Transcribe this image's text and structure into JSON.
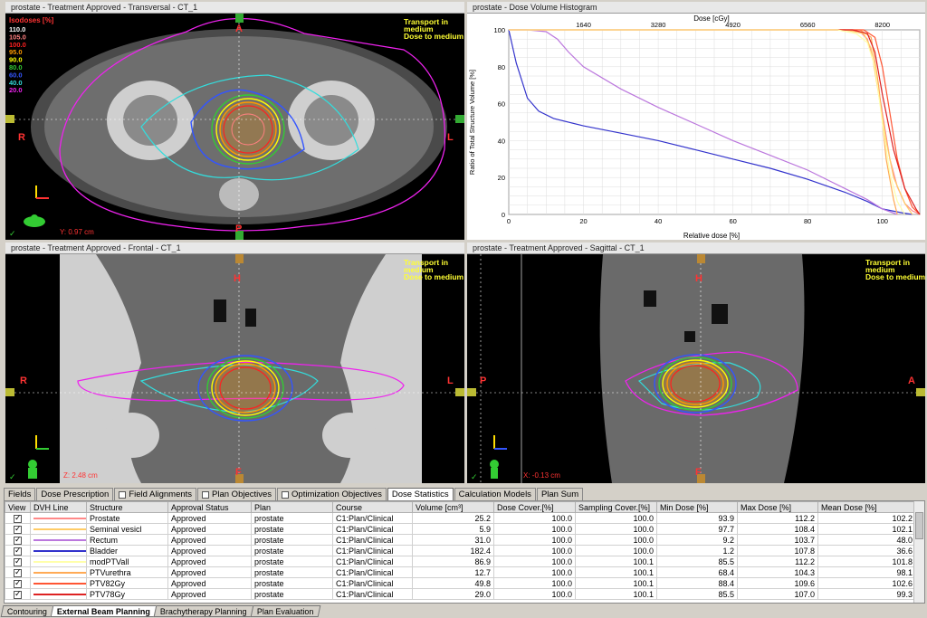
{
  "viewports": {
    "transversal": {
      "title": "prostate  -  Treatment Approved - Transversal - CT_1",
      "pos_readout": "Y: 0.97 cm",
      "orient": {
        "top": "A",
        "bottom": "P",
        "left": "R",
        "right": "L"
      }
    },
    "dvh": {
      "title": "prostate  -  Dose Volume Histogram"
    },
    "frontal": {
      "title": "prostate  -  Treatment Approved - Frontal - CT_1",
      "pos_readout": "Z: 2.48 cm",
      "orient": {
        "top": "H",
        "bottom": "F",
        "left": "R",
        "right": "L"
      }
    },
    "sagittal": {
      "title": "prostate  -  Treatment Approved - Sagittal - CT_1",
      "pos_readout": "X: -0.13 cm",
      "orient": {
        "top": "H",
        "bottom": "F",
        "left": "P",
        "right": "A"
      }
    }
  },
  "transport_lines": [
    "Transport in",
    "medium",
    "Dose to medium"
  ],
  "isodose_legend": {
    "title": "Isodoses [%]",
    "levels": [
      {
        "label": "110.0",
        "color": "#ffffff"
      },
      {
        "label": "105.0",
        "color": "#ff8080"
      },
      {
        "label": "100.0",
        "color": "#ff2020"
      },
      {
        "label": "95.0",
        "color": "#ff9900"
      },
      {
        "label": "90.0",
        "color": "#ffff00"
      },
      {
        "label": "80.0",
        "color": "#33cc33"
      },
      {
        "label": "60.0",
        "color": "#3355ff"
      },
      {
        "label": "40.0",
        "color": "#33dddd"
      },
      {
        "label": "20.0",
        "color": "#ee22ee"
      }
    ]
  },
  "chart_data": {
    "type": "line",
    "title": "",
    "xlabel": "Relative dose [%]",
    "x2label": "Dose [cGy]",
    "ylabel": "Ratio of Total Structure Volume [%]",
    "xlim": [
      0,
      110
    ],
    "ylim": [
      0,
      100
    ],
    "x_ticks": [
      0,
      20,
      40,
      60,
      80,
      100
    ],
    "y_ticks": [
      0,
      20,
      40,
      60,
      80,
      100
    ],
    "x2_ticks": [
      1640,
      3280,
      4920,
      6560,
      8200
    ],
    "grid": true,
    "series": [
      {
        "name": "Bladder",
        "color": "#3333cc",
        "x": [
          0,
          2,
          5,
          8,
          12,
          20,
          30,
          40,
          50,
          60,
          70,
          80,
          90,
          96,
          100,
          105,
          108
        ],
        "y": [
          100,
          82,
          63,
          56,
          52,
          48,
          44,
          40,
          35,
          30,
          25,
          19,
          12,
          7,
          3,
          1,
          0
        ]
      },
      {
        "name": "Rectum",
        "color": "#bb77dd",
        "x": [
          0,
          5,
          10,
          13,
          16,
          20,
          30,
          40,
          50,
          60,
          70,
          80,
          90,
          96,
          100,
          104
        ],
        "y": [
          100,
          100,
          99,
          95,
          88,
          80,
          68,
          58,
          49,
          40,
          32,
          24,
          14,
          8,
          3,
          0
        ]
      },
      {
        "name": "Prostate",
        "color": "#ff8888",
        "x": [
          0,
          90,
          94,
          96,
          98,
          100,
          102,
          104,
          106,
          108,
          110
        ],
        "y": [
          100,
          100,
          99,
          95,
          80,
          55,
          30,
          15,
          6,
          2,
          0
        ]
      },
      {
        "name": "Seminal vesicl",
        "color": "#ffcc66",
        "x": [
          0,
          90,
          95,
          97,
          99,
          101,
          103,
          106,
          108
        ],
        "y": [
          100,
          100,
          98,
          90,
          65,
          40,
          20,
          6,
          0
        ]
      },
      {
        "name": "PTVurethra",
        "color": "#ffaa55",
        "x": [
          0,
          94,
          97,
          99,
          101,
          103,
          104
        ],
        "y": [
          100,
          100,
          96,
          70,
          30,
          8,
          0
        ]
      },
      {
        "name": "PTV82Gy",
        "color": "#ff5533",
        "x": [
          0,
          95,
          98,
          100,
          102,
          104,
          106,
          108,
          110
        ],
        "y": [
          100,
          100,
          96,
          80,
          55,
          30,
          14,
          4,
          0
        ]
      },
      {
        "name": "PTV78Gy",
        "color": "#dd2222",
        "x": [
          0,
          92,
          96,
          98,
          100,
          103,
          106,
          109,
          110
        ],
        "y": [
          100,
          100,
          98,
          88,
          65,
          35,
          14,
          3,
          0
        ]
      },
      {
        "name": "modPTVall",
        "color": "#ffffaa",
        "x": [
          0,
          88,
          93,
          96,
          98,
          100,
          102,
          104,
          106
        ],
        "y": [
          100,
          100,
          98,
          93,
          80,
          50,
          22,
          7,
          0
        ]
      }
    ]
  },
  "tabs": [
    {
      "label": "Fields",
      "checkbox": false,
      "active": false
    },
    {
      "label": "Dose Prescription",
      "checkbox": false,
      "active": false
    },
    {
      "label": "Field Alignments",
      "checkbox": true,
      "active": false
    },
    {
      "label": "Plan Objectives",
      "checkbox": true,
      "active": false
    },
    {
      "label": "Optimization Objectives",
      "checkbox": true,
      "active": false
    },
    {
      "label": "Dose Statistics",
      "checkbox": false,
      "active": true
    },
    {
      "label": "Calculation Models",
      "checkbox": false,
      "active": false
    },
    {
      "label": "Plan Sum",
      "checkbox": false,
      "active": false
    }
  ],
  "table": {
    "columns": [
      "View",
      "DVH Line",
      "Structure",
      "Approval Status",
      "Plan",
      "Course",
      "Volume [cm³]",
      "Dose Cover.[%]",
      "Sampling Cover.[%]",
      "Min Dose [%]",
      "Max Dose [%]",
      "Mean Dose [%]"
    ],
    "rows": [
      {
        "color": "#ff8888",
        "structure": "Prostate",
        "status": "Approved",
        "plan": "prostate",
        "course": "C1:Plan/Clinical",
        "volume": "25.2",
        "dose_cover": "100.0",
        "sampling_cover": "100.0",
        "min": "93.9",
        "max": "112.2",
        "mean": "102.2"
      },
      {
        "color": "#ffcc66",
        "structure": "Seminal vesicl",
        "status": "Approved",
        "plan": "prostate",
        "course": "C1:Plan/Clinical",
        "volume": "5.9",
        "dose_cover": "100.0",
        "sampling_cover": "100.0",
        "min": "97.7",
        "max": "108.4",
        "mean": "102.1"
      },
      {
        "color": "#bb77dd",
        "structure": "Rectum",
        "status": "Approved",
        "plan": "prostate",
        "course": "C1:Plan/Clinical",
        "volume": "31.0",
        "dose_cover": "100.0",
        "sampling_cover": "100.0",
        "min": "9.2",
        "max": "103.7",
        "mean": "48.0"
      },
      {
        "color": "#3333cc",
        "structure": "Bladder",
        "status": "Approved",
        "plan": "prostate",
        "course": "C1:Plan/Clinical",
        "volume": "182.4",
        "dose_cover": "100.0",
        "sampling_cover": "100.0",
        "min": "1.2",
        "max": "107.8",
        "mean": "36.6"
      },
      {
        "color": "#ffffaa",
        "structure": "modPTVall",
        "status": "Approved",
        "plan": "prostate",
        "course": "C1:Plan/Clinical",
        "volume": "86.9",
        "dose_cover": "100.0",
        "sampling_cover": "100.1",
        "min": "85.5",
        "max": "112.2",
        "mean": "101.8"
      },
      {
        "color": "#ffaa55",
        "structure": "PTVurethra",
        "status": "Approved",
        "plan": "prostate",
        "course": "C1:Plan/Clinical",
        "volume": "12.7",
        "dose_cover": "100.0",
        "sampling_cover": "100.1",
        "min": "68.4",
        "max": "104.3",
        "mean": "98.1"
      },
      {
        "color": "#ff5533",
        "structure": "PTV82Gy",
        "status": "Approved",
        "plan": "prostate",
        "course": "C1:Plan/Clinical",
        "volume": "49.8",
        "dose_cover": "100.0",
        "sampling_cover": "100.1",
        "min": "88.4",
        "max": "109.6",
        "mean": "102.6"
      },
      {
        "color": "#dd2222",
        "structure": "PTV78Gy",
        "status": "Approved",
        "plan": "prostate",
        "course": "C1:Plan/Clinical",
        "volume": "29.0",
        "dose_cover": "100.0",
        "sampling_cover": "100.1",
        "min": "85.5",
        "max": "107.0",
        "mean": "99.3"
      }
    ]
  },
  "workspace_tabs": [
    {
      "label": "Contouring",
      "active": false
    },
    {
      "label": "External Beam Planning",
      "active": true
    },
    {
      "label": "Brachytherapy Planning",
      "active": false
    },
    {
      "label": "Plan Evaluation",
      "active": false
    }
  ]
}
